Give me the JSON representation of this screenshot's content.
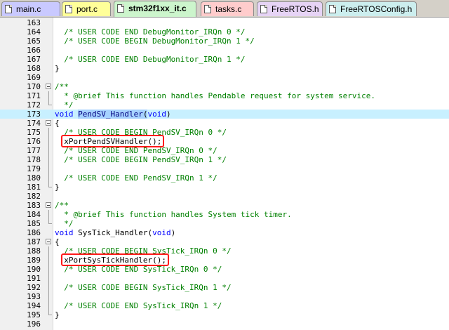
{
  "tabs": [
    {
      "label": "main.c",
      "color": "#c9c9ff",
      "active": false
    },
    {
      "label": "port.c",
      "color": "#ffff99",
      "active": false
    },
    {
      "label": "stm32f1xx_it.c",
      "color": "#ccf5cc",
      "active": true
    },
    {
      "label": "tasks.c",
      "color": "#ffcccc",
      "active": false
    },
    {
      "label": "FreeRTOS.h",
      "color": "#e6d3f5",
      "active": false
    },
    {
      "label": "FreeRTOSConfig.h",
      "color": "#cceeee",
      "active": false
    }
  ],
  "code_lines": [
    {
      "n": "163",
      "parts": []
    },
    {
      "n": "164",
      "parts": [
        {
          "t": "  /* USER CODE END DebugMonitor_IRQn 0 */",
          "c": "cm"
        }
      ]
    },
    {
      "n": "165",
      "parts": [
        {
          "t": "  /* USER CODE BEGIN DebugMonitor_IRQn 1 */",
          "c": "cm"
        }
      ]
    },
    {
      "n": "166",
      "parts": []
    },
    {
      "n": "167",
      "parts": [
        {
          "t": "  /* USER CODE END DebugMonitor_IRQn 1 */",
          "c": "cm"
        }
      ]
    },
    {
      "n": "168",
      "parts": [
        {
          "t": "}",
          "c": "pn"
        }
      ]
    },
    {
      "n": "169",
      "parts": []
    },
    {
      "n": "170",
      "fold": "box",
      "parts": [
        {
          "t": "/**",
          "c": "cm"
        }
      ]
    },
    {
      "n": "171",
      "fold": "line",
      "parts": [
        {
          "t": "  * @brief This function handles Pendable request for system service.",
          "c": "cm"
        }
      ]
    },
    {
      "n": "172",
      "fold": "end",
      "parts": [
        {
          "t": "  */",
          "c": "cm"
        }
      ]
    },
    {
      "n": "173",
      "highlight": true,
      "parts": [
        {
          "t": "void",
          "c": "kw"
        },
        {
          "t": " ",
          "c": "pn"
        },
        {
          "t": "PendSV_Handler",
          "c": "fn",
          "sel": true
        },
        {
          "t": "(",
          "c": "pn",
          "sel": true
        },
        {
          "t": "void",
          "c": "kw"
        },
        {
          "t": ")",
          "c": "pn"
        }
      ]
    },
    {
      "n": "174",
      "fold": "box",
      "parts": [
        {
          "t": "{",
          "c": "pn"
        }
      ]
    },
    {
      "n": "175",
      "fold": "line",
      "parts": [
        {
          "t": "  /* USER CODE BEGIN PendSV_IRQn 0 */",
          "c": "cm"
        }
      ]
    },
    {
      "n": "176",
      "fold": "line",
      "parts": [
        {
          "t": "  xPortPendSVHandler();",
          "c": "pn"
        }
      ]
    },
    {
      "n": "177",
      "fold": "line",
      "parts": [
        {
          "t": "  /* USER CODE END PendSV_IRQn 0 */",
          "c": "cm"
        }
      ]
    },
    {
      "n": "178",
      "fold": "line",
      "parts": [
        {
          "t": "  /* USER CODE BEGIN PendSV_IRQn 1 */",
          "c": "cm"
        }
      ]
    },
    {
      "n": "179",
      "fold": "line",
      "parts": []
    },
    {
      "n": "180",
      "fold": "line",
      "parts": [
        {
          "t": "  /* USER CODE END PendSV_IRQn 1 */",
          "c": "cm"
        }
      ]
    },
    {
      "n": "181",
      "fold": "end",
      "parts": [
        {
          "t": "}",
          "c": "pn"
        }
      ]
    },
    {
      "n": "182",
      "parts": []
    },
    {
      "n": "183",
      "fold": "box",
      "parts": [
        {
          "t": "/**",
          "c": "cm"
        }
      ]
    },
    {
      "n": "184",
      "fold": "line",
      "parts": [
        {
          "t": "  * @brief This function handles System tick timer.",
          "c": "cm"
        }
      ]
    },
    {
      "n": "185",
      "fold": "end",
      "parts": [
        {
          "t": "  */",
          "c": "cm"
        }
      ]
    },
    {
      "n": "186",
      "parts": [
        {
          "t": "void",
          "c": "kw"
        },
        {
          "t": " SysTick_Handler(",
          "c": "pn"
        },
        {
          "t": "void",
          "c": "kw"
        },
        {
          "t": ")",
          "c": "pn"
        }
      ]
    },
    {
      "n": "187",
      "fold": "box",
      "parts": [
        {
          "t": "{",
          "c": "pn"
        }
      ]
    },
    {
      "n": "188",
      "fold": "line",
      "parts": [
        {
          "t": "  /* USER CODE BEGIN SysTick_IRQn 0 */",
          "c": "cm"
        }
      ]
    },
    {
      "n": "189",
      "fold": "line",
      "parts": [
        {
          "t": "  xPortSysTickHandler();",
          "c": "pn"
        }
      ]
    },
    {
      "n": "190",
      "fold": "line",
      "parts": [
        {
          "t": "  /* USER CODE END SysTick_IRQn 0 */",
          "c": "cm"
        }
      ]
    },
    {
      "n": "191",
      "fold": "line",
      "parts": []
    },
    {
      "n": "192",
      "fold": "line",
      "parts": [
        {
          "t": "  /* USER CODE BEGIN SysTick_IRQn 1 */",
          "c": "cm"
        }
      ]
    },
    {
      "n": "193",
      "fold": "line",
      "parts": []
    },
    {
      "n": "194",
      "fold": "line",
      "parts": [
        {
          "t": "  /* USER CODE END SysTick_IRQn 1 */",
          "c": "cm"
        }
      ]
    },
    {
      "n": "195",
      "fold": "end",
      "parts": [
        {
          "t": "}",
          "c": "pn"
        }
      ]
    },
    {
      "n": "196",
      "parts": []
    }
  ],
  "annotations": [
    {
      "line": "176",
      "target": "xPortPendSVHandler();",
      "color": "#ff1a1a"
    },
    {
      "line": "189",
      "target": "xPortSysTickHandler();",
      "color": "#ff1a1a"
    }
  ]
}
